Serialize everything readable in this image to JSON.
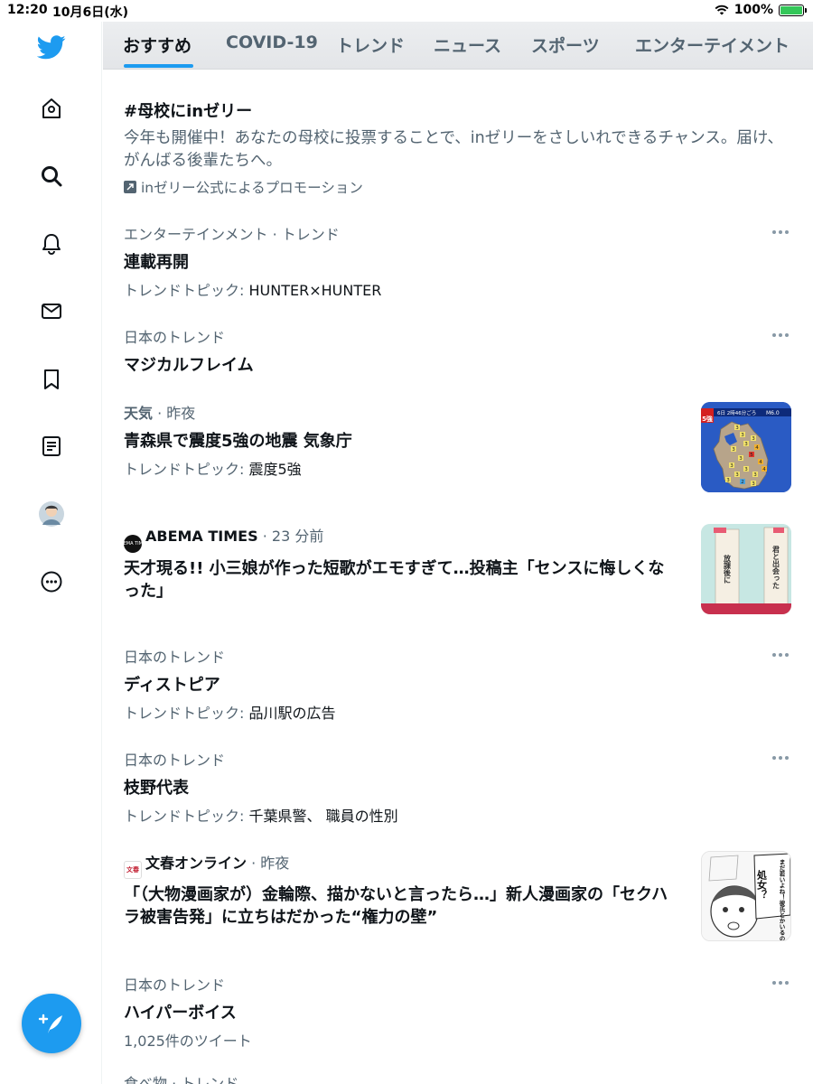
{
  "status_bar": {
    "time": "12:20",
    "date": "10月6日(水)",
    "battery": "100%",
    "battery_level": 1.0
  },
  "colors": {
    "accent": "#1d9bf0",
    "text_primary": "#0f1419",
    "text_secondary": "#536471"
  },
  "sidebar": {
    "items": [
      {
        "icon": "twitter-bird-icon"
      },
      {
        "icon": "home-icon"
      },
      {
        "icon": "search-icon"
      },
      {
        "icon": "bell-icon"
      },
      {
        "icon": "mail-icon"
      },
      {
        "icon": "bookmark-icon"
      },
      {
        "icon": "list-icon"
      },
      {
        "icon": "avatar"
      },
      {
        "icon": "more-circle-icon"
      }
    ],
    "compose_icon": "compose-tweet-icon"
  },
  "tabs": [
    {
      "label": "おすすめ",
      "active": true
    },
    {
      "label": "COVID-19",
      "active": false
    },
    {
      "label": "トレンド",
      "active": false
    },
    {
      "label": "ニュース",
      "active": false
    },
    {
      "label": "スポーツ",
      "active": false
    },
    {
      "label": "エンターテイメント",
      "active": false
    }
  ],
  "promo": {
    "title": "#母校にinゼリー",
    "description": "今年も開催中！あなたの母校に投票することで、inゼリーをさしいれできるチャンス。届け、がんばる後輩たちへ。",
    "promoted_by": "inゼリー公式によるプロモーション"
  },
  "trends": [
    {
      "category": "エンターテインメント · トレンド",
      "title": "連載再開",
      "topic_label": "トレンドトピック: ",
      "topic": "HUNTER×HUNTER"
    },
    {
      "category": "日本のトレンド",
      "title": "マジカルフレイム"
    },
    {
      "category": "天気",
      "time": " · 昨夜",
      "title": "青森県で震度5強の地震 気象庁",
      "topic_label": "トレンドトピック: ",
      "topic": "震度5強"
    },
    {
      "source": "ABEMA TIMES",
      "logo_text": "ABEMA TIMES",
      "time": " · 23 分前",
      "title": "天才現る!! 小三娘が作った短歌がエモすぎて…投稿主「センスに悔しくなった」"
    },
    {
      "category": "日本のトレンド",
      "title": "ディストピア",
      "topic_label": "トレンドトピック: ",
      "topic": "品川駅の広告"
    },
    {
      "category": "日本のトレンド",
      "title": "枝野代表",
      "topic_label": "トレンドトピック: ",
      "topic": "千葉県警、 職員の性別"
    },
    {
      "source": "文春オンライン",
      "logo_text": "文春",
      "time": " · 昨夜",
      "title": "「（大物漫画家が）金輪際、描かないと言ったら…」新人漫画家の「セクハラ被害告発」に立ちはだかった“権力の壁”"
    },
    {
      "category": "日本のトレンド",
      "title": "ハイパーボイス",
      "count": "1,025件のツイート"
    },
    {
      "category": "食べ物 · トレンド"
    }
  ],
  "thumbnails": {
    "earthquake": {
      "badge": "5強",
      "header": "6日 2時46分ごろ",
      "magnitude": "M6.0",
      "intensity_marks": [
        "3",
        "3",
        "3",
        "3",
        "3",
        "4",
        "5",
        "3",
        "4",
        "3",
        "3",
        "3",
        "3",
        "4",
        "3",
        "2",
        "3"
      ]
    },
    "tanka": {
      "card_left": "放課後に",
      "card_right": "君と出会った"
    },
    "manga": {
      "bubble_text": "まだ若いよね！彼氏とかいるの？",
      "bubble_big": "処女？"
    }
  }
}
